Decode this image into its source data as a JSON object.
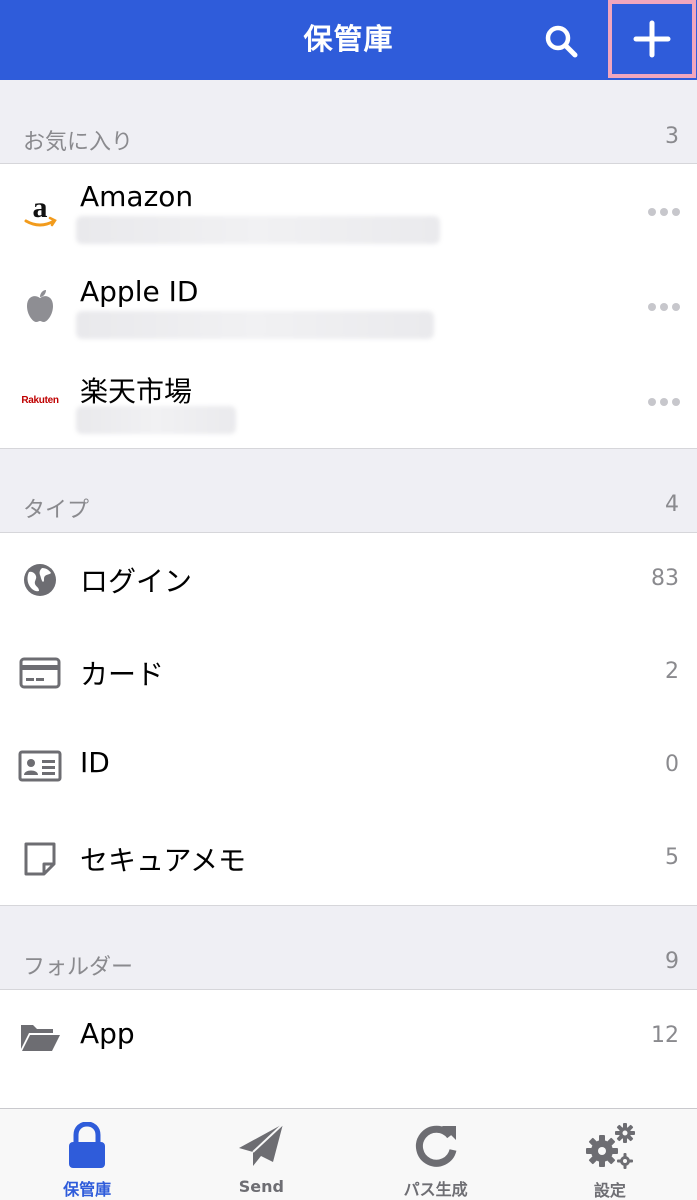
{
  "header": {
    "title": "保管庫",
    "accent": "#2f5cda",
    "search_icon": "search-icon",
    "add_icon": "plus-icon"
  },
  "favorites": {
    "label": "お気に入り",
    "count": "3",
    "items": [
      {
        "title": "Amazon",
        "icon": "amazon-logo-icon"
      },
      {
        "title": "Apple ID",
        "icon": "apple-logo-icon"
      },
      {
        "title": "楽天市場",
        "icon": "rakuten-logo-icon",
        "logo_text": "Rakuten"
      }
    ]
  },
  "types": {
    "label": "タイプ",
    "count": "4",
    "items": [
      {
        "title": "ログイン",
        "count": "83",
        "icon": "globe-icon"
      },
      {
        "title": "カード",
        "count": "2",
        "icon": "credit-card-icon"
      },
      {
        "title": "ID",
        "count": "0",
        "icon": "id-card-icon"
      },
      {
        "title": "セキュアメモ",
        "count": "5",
        "icon": "note-icon"
      }
    ]
  },
  "folders": {
    "label": "フォルダー",
    "count": "9",
    "items": [
      {
        "title": "App",
        "count": "12",
        "icon": "folder-open-icon"
      }
    ]
  },
  "tabs": [
    {
      "label": "保管庫",
      "icon": "lock-icon",
      "active": true
    },
    {
      "label": "Send",
      "icon": "paper-plane-icon",
      "active": false
    },
    {
      "label": "パス生成",
      "icon": "refresh-icon",
      "active": false
    },
    {
      "label": "設定",
      "icon": "gears-icon",
      "active": false
    }
  ]
}
